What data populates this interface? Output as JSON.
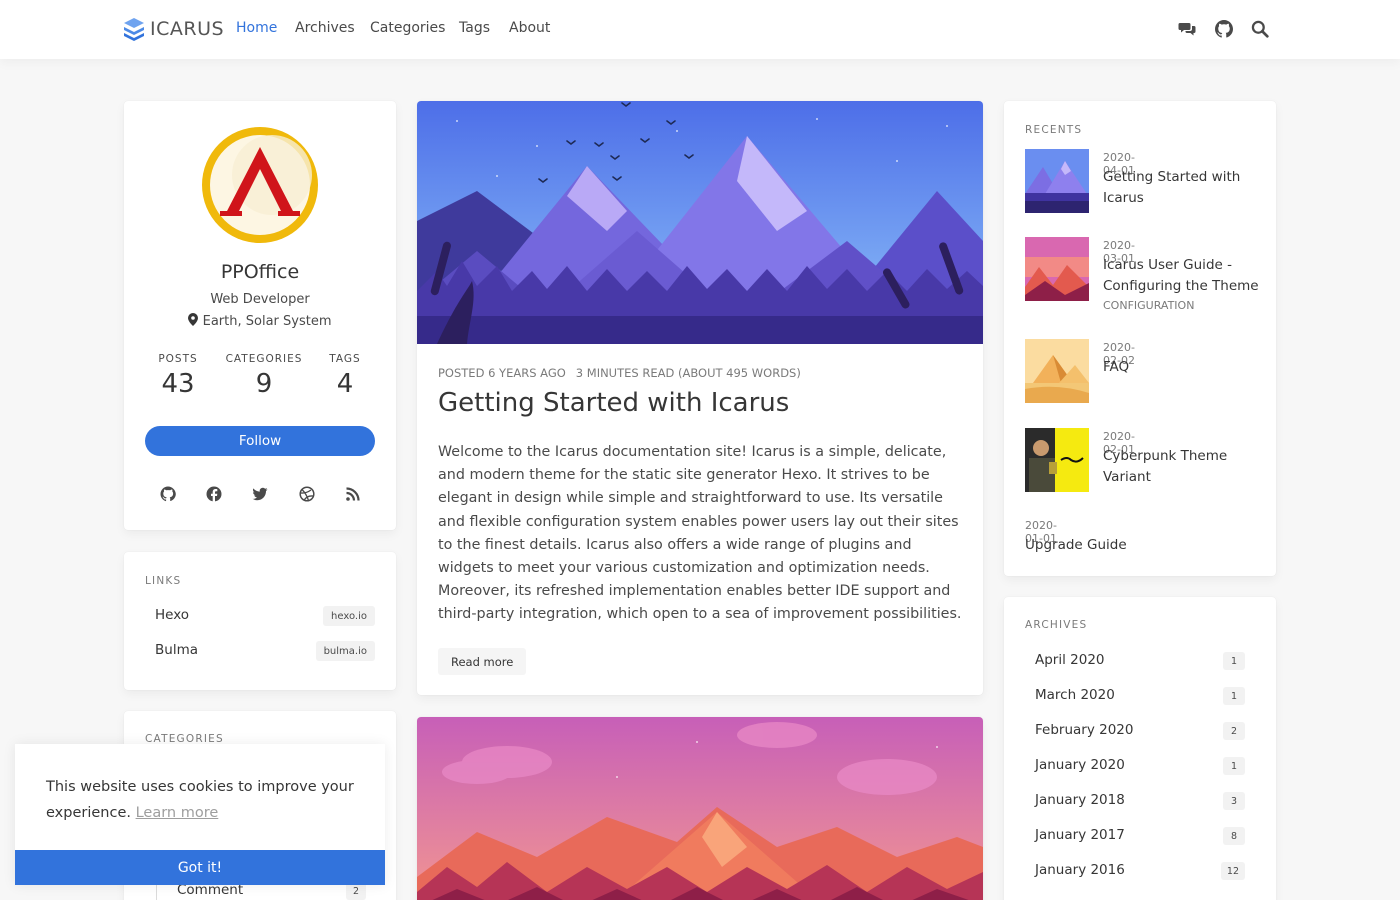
{
  "navbar": {
    "logo_text": "ICARUS",
    "items": [
      {
        "label": "Home",
        "active": true
      },
      {
        "label": "Archives"
      },
      {
        "label": "Categories"
      },
      {
        "label": "Tags"
      },
      {
        "label": "About"
      }
    ],
    "icons": [
      "comments-icon",
      "github-icon",
      "search-icon"
    ],
    "accent_color": "#3273dc"
  },
  "profile": {
    "name": "PPOffice",
    "role": "Web Developer",
    "location": "Earth, Solar System",
    "stats": [
      {
        "label": "POSTS",
        "value": "43"
      },
      {
        "label": "CATEGORIES",
        "value": "9"
      },
      {
        "label": "TAGS",
        "value": "4"
      }
    ],
    "follow_label": "Follow",
    "socials": [
      "github-icon",
      "facebook-icon",
      "twitter-icon",
      "dribbble-icon",
      "rss-icon"
    ]
  },
  "links": {
    "label": "LINKS",
    "items": [
      {
        "name": "Hexo",
        "tag": "hexo.io"
      },
      {
        "name": "Bulma",
        "tag": "bulma.io"
      }
    ]
  },
  "categories": {
    "label": "CATEGORIES",
    "visible_item": {
      "name": "Comment",
      "count": "2"
    }
  },
  "article": {
    "posted": "POSTED 6 YEARS AGO",
    "read": "3 MINUTES READ (ABOUT 495 WORDS)",
    "title": "Getting Started with Icarus",
    "body": "Welcome to the Icarus documentation site! Icarus is a simple, delicate, and modern theme for the static site generator Hexo. It strives to be elegant in design while simple and straightforward to use. Its versatile and flexible configuration system enables power users lay out their sites to the finest details. Icarus also offers a wide range of plugins and widgets to meet your various customization and optimization needs. Moreover, its refreshed implementation enables better IDE support and third-party integration, which open to a sea of improvement possibilities.",
    "read_more": "Read more"
  },
  "recents": {
    "label": "RECENTS",
    "items": [
      {
        "date": "2020-04-01",
        "title": "Getting Started with Icarus",
        "category": ""
      },
      {
        "date": "2020-03-01",
        "title": "Icarus User Guide - Configuring the Theme",
        "category": "CONFIGURATION"
      },
      {
        "date": "2020-02-02",
        "title": "FAQ",
        "category": ""
      },
      {
        "date": "2020-02-01",
        "title": "Cyberpunk Theme Variant",
        "category": ""
      },
      {
        "date": "2020-01-01",
        "title": "Upgrade Guide",
        "category": ""
      }
    ]
  },
  "archives": {
    "label": "ARCHIVES",
    "items": [
      {
        "name": "April 2020",
        "count": "1"
      },
      {
        "name": "March 2020",
        "count": "1"
      },
      {
        "name": "February 2020",
        "count": "2"
      },
      {
        "name": "January 2020",
        "count": "1"
      },
      {
        "name": "January 2018",
        "count": "3"
      },
      {
        "name": "January 2017",
        "count": "8"
      },
      {
        "name": "January 2016",
        "count": "12"
      }
    ]
  },
  "cookie": {
    "text": "This website uses cookies to improve your experience.",
    "link": "Learn more",
    "button": "Got it!"
  }
}
